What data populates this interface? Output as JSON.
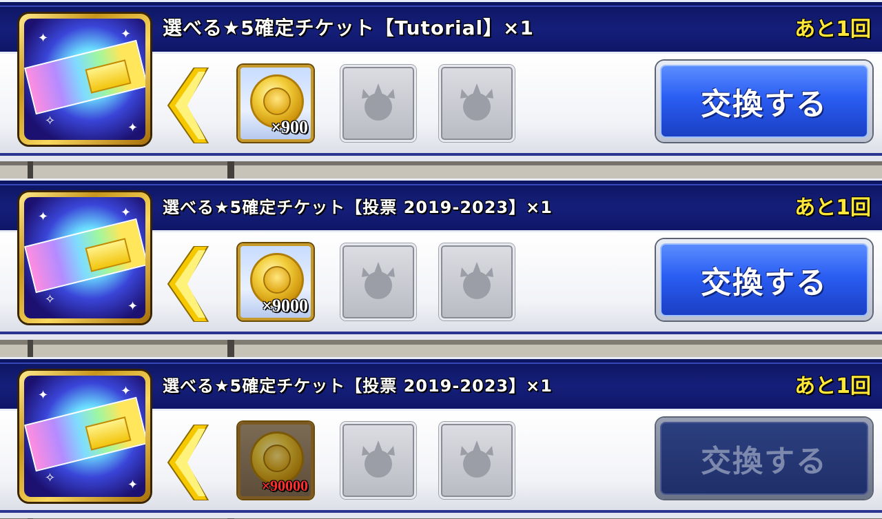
{
  "rows": [
    {
      "title": "選べる★5確定チケット【Tutorial】×1",
      "remaining": "あと1回",
      "cost_quantity": "×900",
      "exchange_label": "交換する",
      "enabled": true
    },
    {
      "title": "選べる★5確定チケット【投票 2019-2023】×1",
      "remaining": "あと1回",
      "cost_quantity": "×9000",
      "exchange_label": "交換する",
      "enabled": true
    },
    {
      "title": "選べる★5確定チケット【投票 2019-2023】×1",
      "remaining": "あと1回",
      "cost_quantity": "×90000",
      "exchange_label": "交換する",
      "enabled": false
    }
  ],
  "icons": {
    "reward": "ticket-icon",
    "arrow": "chevron-left-icon",
    "currency": "coin-icon",
    "empty_slot": "paw-icon"
  },
  "colors": {
    "header_bg": "#151f7a",
    "remaining_text": "#ffe83a",
    "button_blue": "#2a5df2",
    "insufficient_qty": "#ff2e2e"
  }
}
